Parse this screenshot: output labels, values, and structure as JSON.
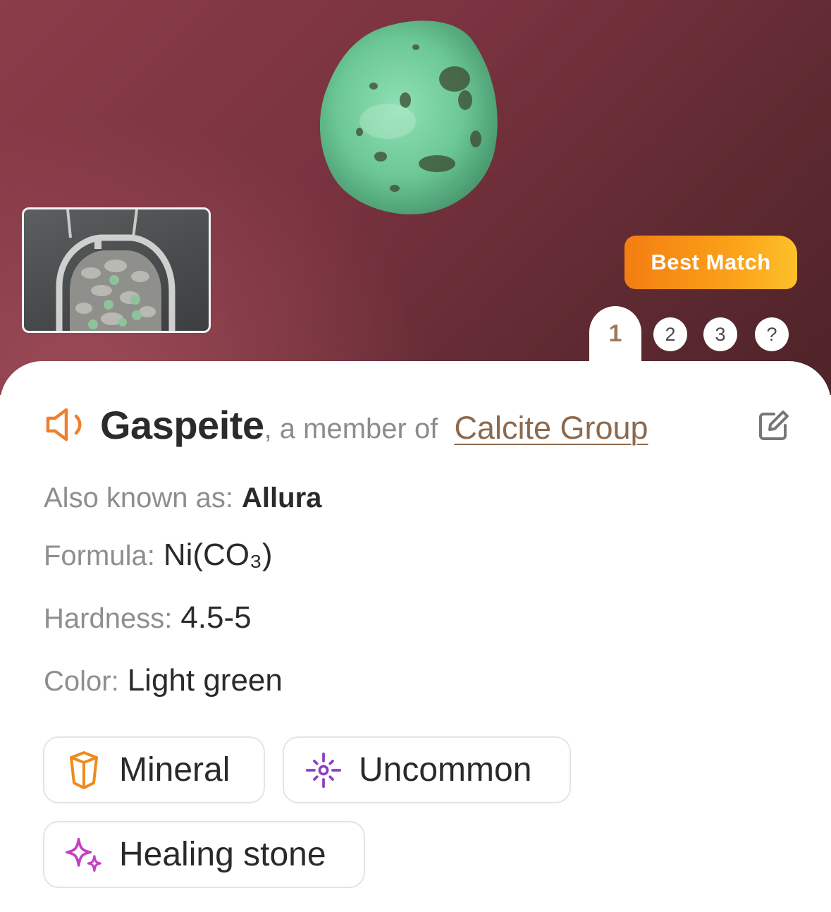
{
  "badge": {
    "label": "Best Match"
  },
  "tabs": [
    {
      "label": "1",
      "active": true
    },
    {
      "label": "2"
    },
    {
      "label": "3"
    },
    {
      "label": "?"
    }
  ],
  "result": {
    "name": "Gaspeite",
    "member_prefix": ", a member of ",
    "group": "Calcite Group"
  },
  "properties": [
    {
      "label": "Also known as:",
      "value": "Allura"
    },
    {
      "label": "Formula:",
      "value": "Ni(CO₃)"
    },
    {
      "label": "Hardness:",
      "value": "4.5-5"
    },
    {
      "label": "Color:",
      "value": "Light green"
    }
  ],
  "chips": [
    {
      "label": "Mineral",
      "icon": "crystal-icon",
      "color": "#ef8a1f"
    },
    {
      "label": "Uncommon",
      "icon": "sparkle-burst-icon",
      "color": "#8a3fc6"
    },
    {
      "label": "Healing stone",
      "icon": "sparkles-icon",
      "color": "#c43fc4"
    }
  ],
  "colors": {
    "accent_orange": "#f47d12",
    "link_brown": "#8c6a4e",
    "hero_background": "#7a3340",
    "stone_green": "#6fc79a"
  }
}
